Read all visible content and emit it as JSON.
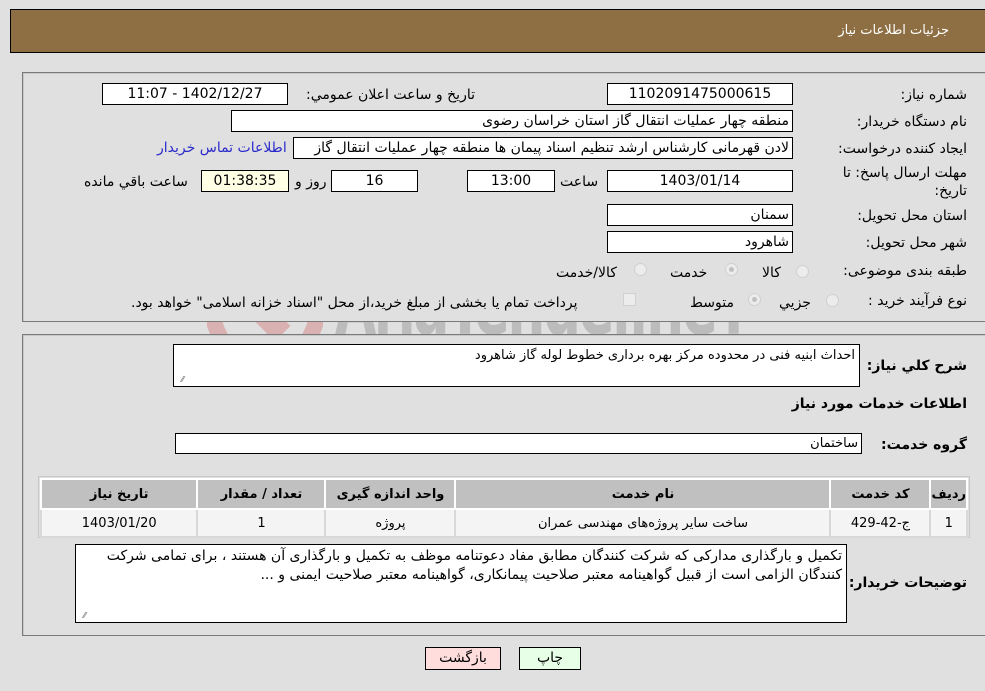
{
  "header": {
    "title": "جزئیات اطلاعات نیاز"
  },
  "fields": {
    "need_number_label": "شماره نیاز:",
    "need_number": "1102091475000615",
    "announce_label": "تاریخ و ساعت اعلان عمومي:",
    "announce_value": "1402/12/27 - 11:07",
    "buyer_org_label": "نام دستگاه خریدار:",
    "buyer_org_value": "منطقه چهار عملیات انتقال گاز   استان خراسان رضوی",
    "creator_label": "ایجاد کننده درخواست:",
    "creator_value": "لادن قهرمانی کارشناس ارشد تنظیم اسناد پیمان ها منطقه چهار عملیات انتقال گاز",
    "buyer_contact_link": "اطلاعات تماس خریدار",
    "deadline_label_1": "مهلت ارسال پاسخ: تا",
    "deadline_label_2": "تاریخ:",
    "deadline_date": "1403/01/14",
    "time_label": "ساعت",
    "deadline_time": "13:00",
    "days_value": "16",
    "days_label": "روز و",
    "remaining_value": "01:38:35",
    "remaining_label": "ساعت باقي مانده",
    "province_label": "استان محل تحویل:",
    "province_value": "سمنان",
    "city_label": "شهر محل تحویل:",
    "city_value": "شاهرود",
    "category_label": "طبقه بندی موضوعی:",
    "category_options": [
      {
        "label": "کالا",
        "checked": false
      },
      {
        "label": "خدمت",
        "checked": true
      },
      {
        "label": "کالا/خدمت",
        "checked": false
      }
    ],
    "process_label": "نوع فرآیند خرید :",
    "process_options": [
      {
        "label": "جزیي",
        "checked": false
      },
      {
        "label": "متوسط",
        "checked": true
      }
    ],
    "treasury_note": "پرداخت تمام یا بخشی از مبلغ خرید،از محل \"اسناد خزانه اسلامی\" خواهد بود."
  },
  "description": {
    "label": "شرح کلي نیاز:",
    "value": "احداث ابنیه فنی در  محدوده مرکز بهره برداری خطوط لوله گاز شاهرود"
  },
  "services": {
    "section_title": "اطلاعات خدمات مورد نیاز",
    "group_label": "گروه خدمت:",
    "group_value": "ساختمان",
    "table": {
      "headers": [
        "ردیف",
        "کد خدمت",
        "نام خدمت",
        "واحد اندازه گیری",
        "تعداد / مقدار",
        "تاریخ نیاز"
      ],
      "rows": [
        [
          "1",
          "ج-42-429",
          "ساخت سایر پروژه‌های مهندسی عمران",
          "پروژه",
          "1",
          "1403/01/20"
        ]
      ]
    }
  },
  "buyer_notes": {
    "label": "توضیحات خریدار:",
    "value": "تکمیل و بارگذاری مدارکی که شرکت کنندگان مطابق مفاد دعوتنامه موظف به تکمیل و بارگذاری آن هستند ، برای تمامی شرکت کنندگان الزامی است از قبیل گواهینامه معتبر صلاحیت پیمانکاری، گواهینامه معتبر صلاحیت ایمنی و ..."
  },
  "buttons": {
    "print": "چاپ",
    "back": "بازگشت"
  },
  "watermark": {
    "text": "AriaTender.neT"
  },
  "colors": {
    "header_bg": "#8e6e43",
    "link": "#2a2acc",
    "back_btn": "#ffdddd",
    "print_btn": "#e6ffe6",
    "remaining_bg": "#ffffe6"
  }
}
